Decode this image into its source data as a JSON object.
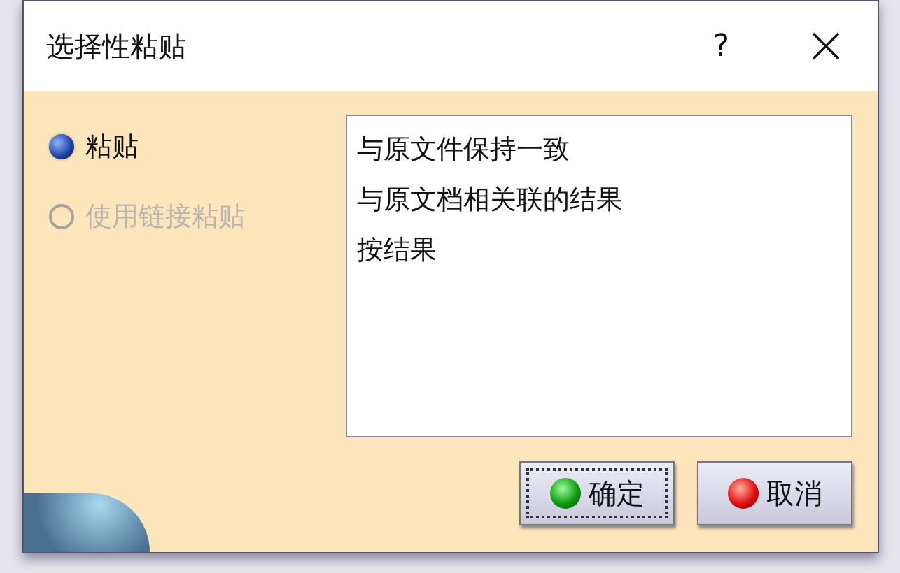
{
  "window": {
    "title": "选择性粘贴",
    "help": "?"
  },
  "paste_options": [
    {
      "label": "粘贴",
      "selected": true,
      "disabled": false
    },
    {
      "label": "使用链接粘贴",
      "selected": false,
      "disabled": true
    }
  ],
  "list": {
    "items": [
      {
        "label": "与原文件保持一致"
      },
      {
        "label": "与原文档相关联的结果"
      },
      {
        "label": "按结果"
      }
    ]
  },
  "buttons": [
    {
      "label": "确定",
      "kind": "ok",
      "focused": true
    },
    {
      "label": "取消",
      "kind": "cancel",
      "focused": false
    }
  ]
}
